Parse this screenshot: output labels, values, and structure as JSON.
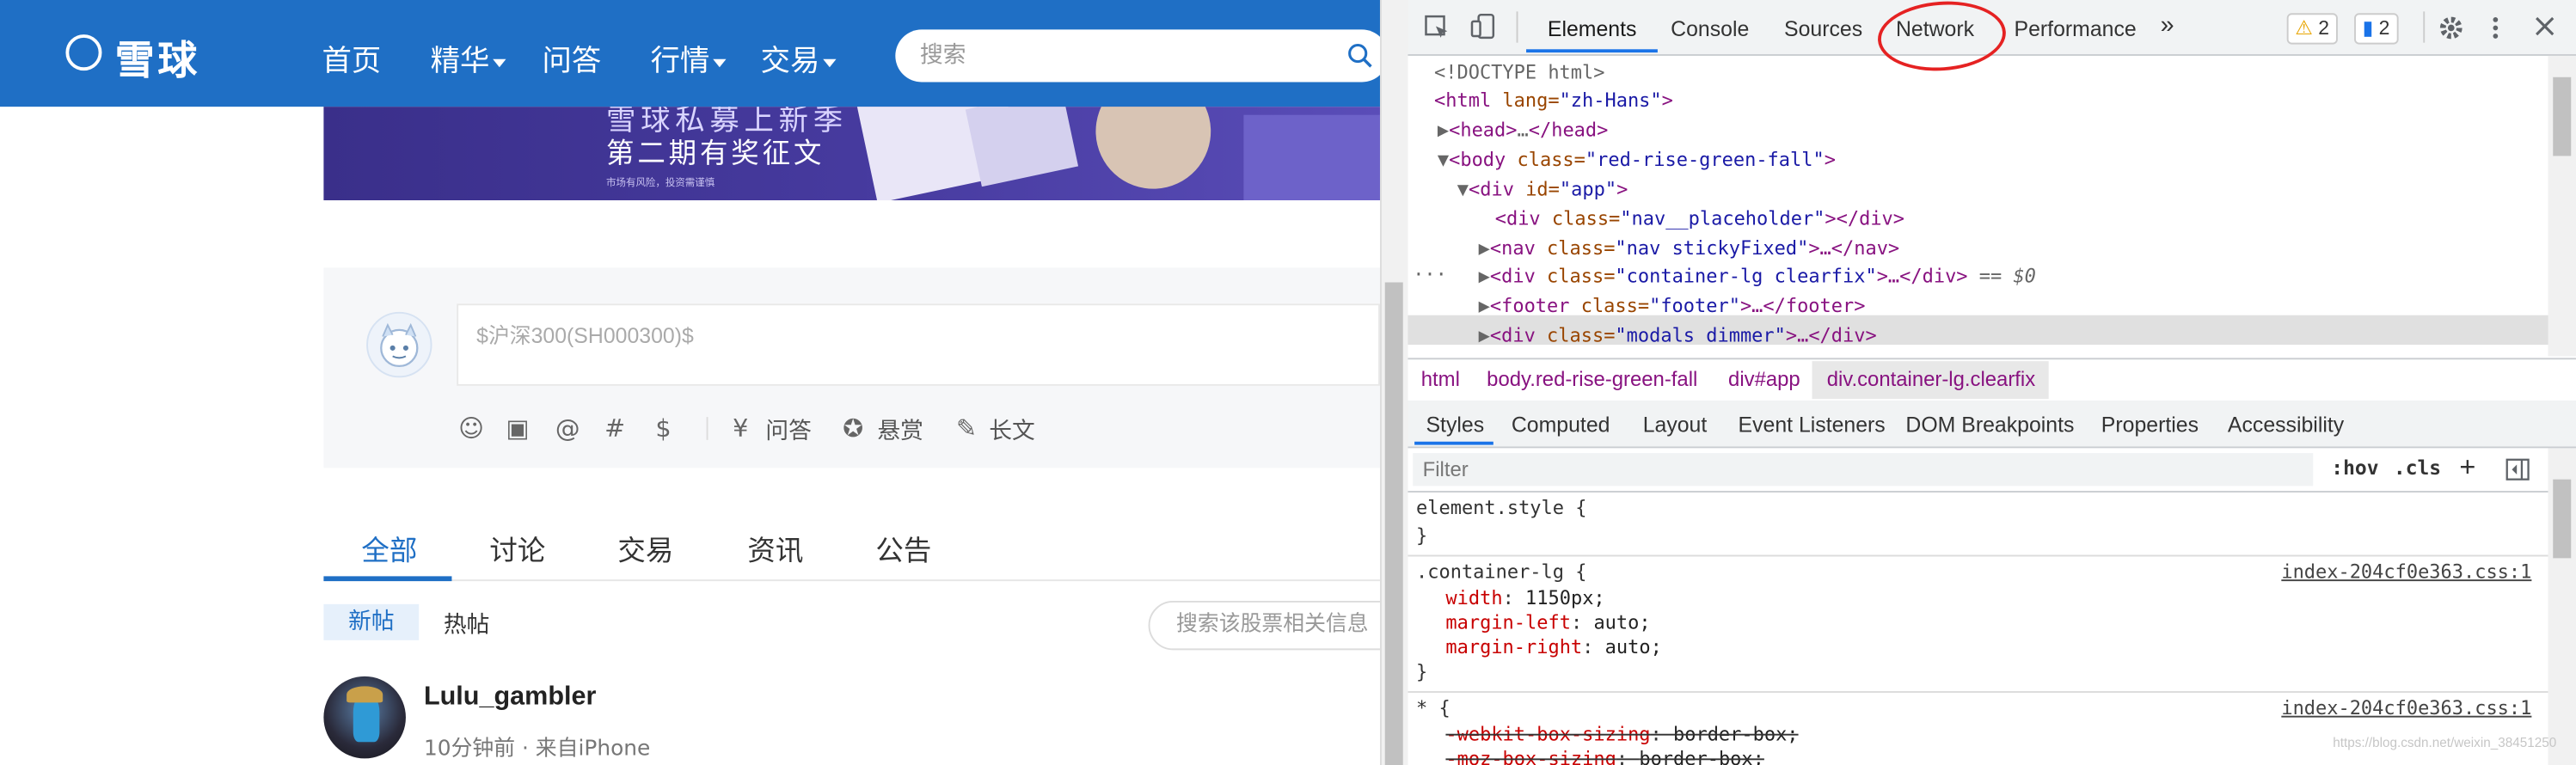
{
  "site": {
    "logo": "雪球",
    "nav": [
      {
        "label": "首页",
        "dropdown": false
      },
      {
        "label": "精华",
        "dropdown": true
      },
      {
        "label": "问答",
        "dropdown": false
      },
      {
        "label": "行情",
        "dropdown": true
      },
      {
        "label": "交易",
        "dropdown": true
      }
    ],
    "search_placeholder": "搜索",
    "banner": {
      "line1": "雪球私募上新季",
      "line2": "第二期有奖征文",
      "footnote": "市场有风险，投资需谨慎"
    },
    "composer": {
      "placeholder": "$沪深300(SH000300)$",
      "tools": [
        "☺",
        "▣",
        "@",
        "#",
        "$"
      ],
      "actions": [
        {
          "icon": "¥",
          "label": "问答"
        },
        {
          "icon": "✪",
          "label": "悬赏"
        },
        {
          "icon": "✎",
          "label": "长文"
        }
      ]
    },
    "tabs": [
      "全部",
      "讨论",
      "交易",
      "资讯",
      "公告"
    ],
    "subtabs": [
      "新帖",
      "热帖"
    ],
    "stock_search_placeholder": "搜索该股票相关信息",
    "post": {
      "username": "Lulu_gambler",
      "meta": "10分钟前 · 来自iPhone"
    }
  },
  "devtools": {
    "tabs": [
      "Elements",
      "Console",
      "Sources",
      "Network",
      "Performance"
    ],
    "more": "»",
    "warnings": "2",
    "messages": "2",
    "elements_lines": [
      {
        "doctype": "<!DOCTYPE html>"
      },
      {
        "t": "<html",
        "a": " lang=",
        "v": "\"zh-Hans\"",
        "e": ">"
      },
      {
        "t": "<head>",
        "rest": "…",
        "close": "</head>"
      },
      {
        "t": "<body",
        "a": " class=",
        "v": "\"red-rise-green-fall\"",
        "e": ">"
      },
      {
        "t": "<div",
        "a": " id=",
        "v": "\"app\"",
        "e": ">"
      },
      {
        "t": "<div",
        "a": " class=",
        "v": "\"nav__placeholder\"",
        "e": "></div>"
      },
      {
        "t": "<nav",
        "a": " class=",
        "v": "\"nav stickyFixed\"",
        "e": ">…</nav>"
      },
      {
        "t": "<div",
        "a": " class=",
        "v": "\"container-lg clearfix\"",
        "e": ">…</div>",
        "suffix": " == $0"
      },
      {
        "t": "<footer",
        "a": " class=",
        "v": "\"footer\"",
        "e": ">…</footer>"
      },
      {
        "t": "<div",
        "a": " class=",
        "v": "\"modals dimmer\"",
        "e": ">…</div>"
      }
    ],
    "breadcrumbs": [
      "html",
      "body.red-rise-green-fall",
      "div#app",
      "div.container-lg.clearfix"
    ],
    "style_tabs": [
      "Styles",
      "Computed",
      "Layout",
      "Event Listeners",
      "DOM Breakpoints",
      "Properties",
      "Accessibility"
    ],
    "filter_placeholder": "Filter",
    "filter_buttons": [
      ":hov",
      ".cls",
      "+"
    ],
    "rules": {
      "element_style": "element.style {",
      "close": "}",
      "container_selector": ".container-lg {",
      "container_source": "index-204cf0e363.css:1",
      "container_props": [
        {
          "p": "width",
          "v": "1150px;"
        },
        {
          "p": "margin-left",
          "v": "auto;"
        },
        {
          "p": "margin-right",
          "v": "auto;"
        }
      ],
      "universal_selector": "* {",
      "universal_source": "index-204cf0e363.css:1",
      "universal_props": [
        {
          "p": "-webkit-box-sizing",
          "v": "border-box;"
        },
        {
          "p": "-moz-box-sizing",
          "v": "border-box;"
        }
      ]
    },
    "watermark": "https://blog.csdn.net/weixin_38451250"
  },
  "colors": {
    "brand": "#1f6fc5",
    "highlight": "#e52222",
    "devtools_accent": "#1a73e8"
  }
}
